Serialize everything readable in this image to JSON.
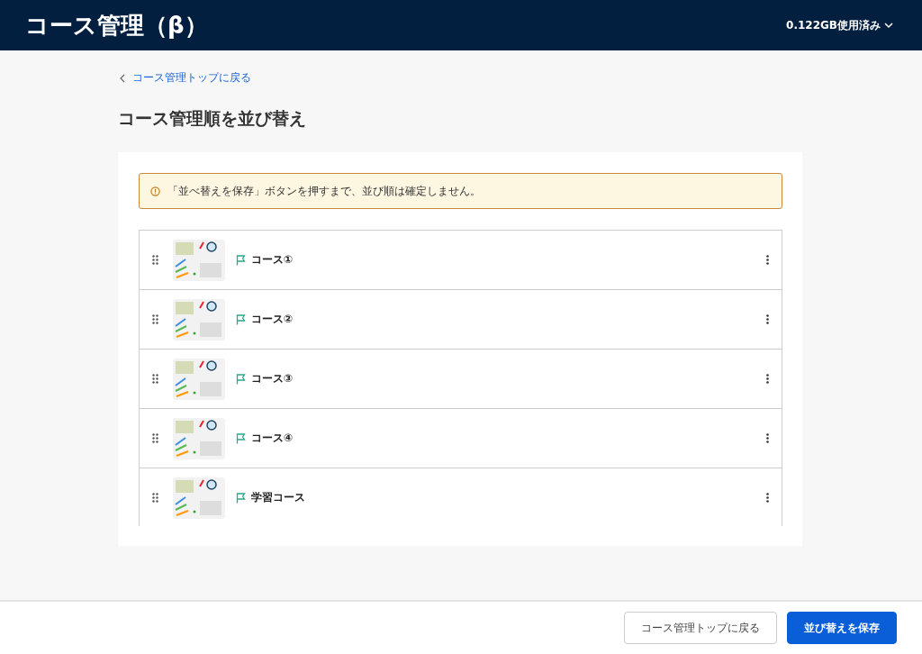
{
  "header": {
    "title": "コース管理（β）",
    "usage": "0.122GB使用済み"
  },
  "back_link": "コース管理トップに戻る",
  "page_title": "コース管理順を並び替え",
  "notice": "「並べ替えを保存」ボタンを押すまで、並び順は確定しません。",
  "courses": [
    {
      "name": "コース①"
    },
    {
      "name": "コース②"
    },
    {
      "name": "コース③"
    },
    {
      "name": "コース④"
    },
    {
      "name": "学習コース"
    }
  ],
  "footer": {
    "buttons": [
      {
        "label": "コース管理トップに戻る",
        "kind": "secondary"
      },
      {
        "label": "並び替えを保存",
        "kind": "primary"
      }
    ]
  }
}
